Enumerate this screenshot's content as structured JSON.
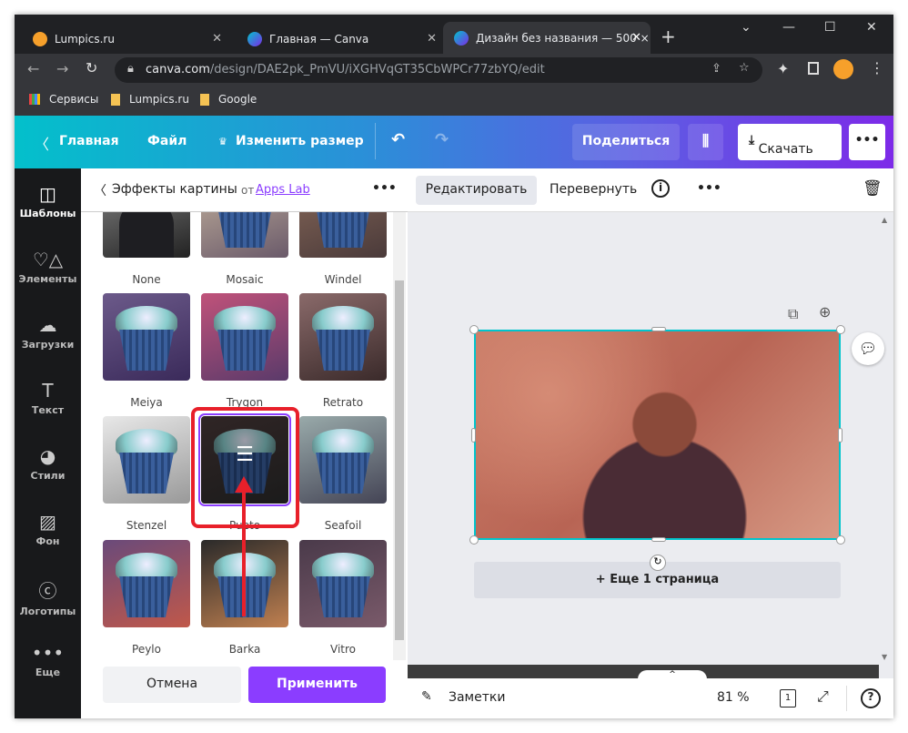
{
  "browser": {
    "tabs": [
      {
        "title": "Lumpics.ru"
      },
      {
        "title": "Главная — Canva"
      },
      {
        "title": "Дизайн без названия — 500 ×"
      }
    ],
    "url_host": "canva.com",
    "url_path": "/design/DAE2pk_PmVU/iXGHVqGT35CbWPCr77zbYQ/edit",
    "bookmarks": [
      "Сервисы",
      "Lumpics.ru",
      "Google"
    ]
  },
  "header": {
    "home": "Главная",
    "file": "Файл",
    "resize": "Изменить размер",
    "share": "Поделиться",
    "download": "Скачать"
  },
  "sidebar": {
    "items": [
      "Шаблоны",
      "Элементы",
      "Загрузки",
      "Текст",
      "Стили",
      "Фон",
      "Логотипы",
      "Еще"
    ]
  },
  "panel": {
    "title": "Эффекты картины",
    "by": "от",
    "author": "Apps Lab",
    "effects": [
      "None",
      "Mosaic",
      "Windel",
      "Meiya",
      "Trygon",
      "Retrato",
      "Stenzel",
      "Pueto",
      "Seafoil",
      "Peylo",
      "Barka",
      "Vitro"
    ],
    "selected": "Pueto",
    "cancel": "Отмена",
    "apply": "Применить"
  },
  "toolbar": {
    "edit": "Редактировать",
    "flip": "Перевернуть"
  },
  "canvas": {
    "add_page": "+ Еще 1 страница"
  },
  "footer": {
    "notes": "Заметки",
    "zoom": "81 %",
    "page": "1"
  },
  "colors": {
    "accent": "#8b3dff",
    "highlight": "#e8202a"
  }
}
